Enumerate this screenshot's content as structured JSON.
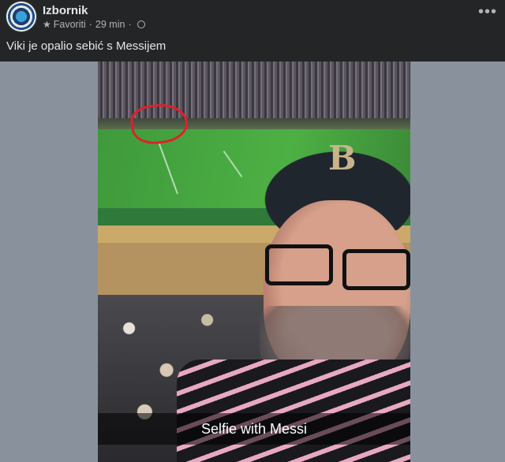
{
  "post": {
    "author": "Izbornik",
    "audience_label": "Favoriti",
    "time": "29 min",
    "more_icon": "…",
    "caption": "Viki je opalio sebić s Messijem"
  },
  "photo": {
    "snap_caption": "Selfie with Messi",
    "cap_logo": "B"
  },
  "icons": {
    "star": "star-icon",
    "globe": "globe-icon",
    "more": "more-options-icon"
  }
}
